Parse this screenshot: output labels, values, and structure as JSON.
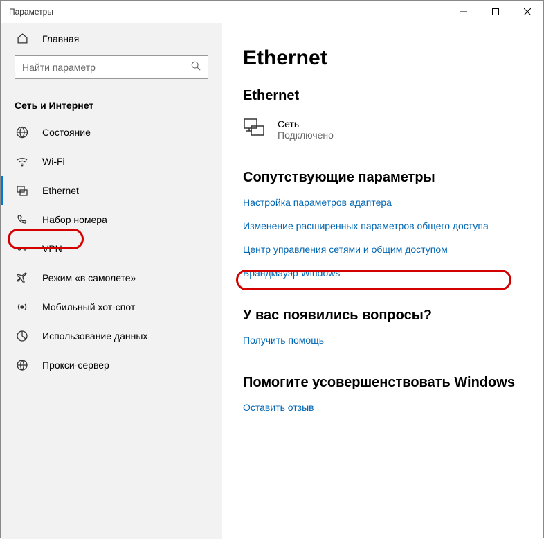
{
  "window": {
    "title": "Параметры"
  },
  "sidebar": {
    "home": "Главная",
    "search_placeholder": "Найти параметр",
    "category": "Сеть и Интернет",
    "items": [
      {
        "label": "Состояние"
      },
      {
        "label": "Wi-Fi"
      },
      {
        "label": "Ethernet"
      },
      {
        "label": "Набор номера"
      },
      {
        "label": "VPN"
      },
      {
        "label": "Режим «в самолете»"
      },
      {
        "label": "Мобильный хот-спот"
      },
      {
        "label": "Использование данных"
      },
      {
        "label": "Прокси-сервер"
      }
    ]
  },
  "main": {
    "page_title": "Ethernet",
    "section1_title": "Ethernet",
    "network": {
      "name": "Сеть",
      "status": "Подключено"
    },
    "related": {
      "title": "Сопутствующие параметры",
      "links": [
        "Настройка параметров адаптера",
        "Изменение расширенных параметров общего доступа",
        "Центр управления сетями и общим доступом",
        "Брандмауэр Windows"
      ]
    },
    "questions": {
      "title": "У вас появились вопросы?",
      "link": "Получить помощь"
    },
    "improve": {
      "title": "Помогите усовершенствовать Windows",
      "link": "Оставить отзыв"
    }
  }
}
